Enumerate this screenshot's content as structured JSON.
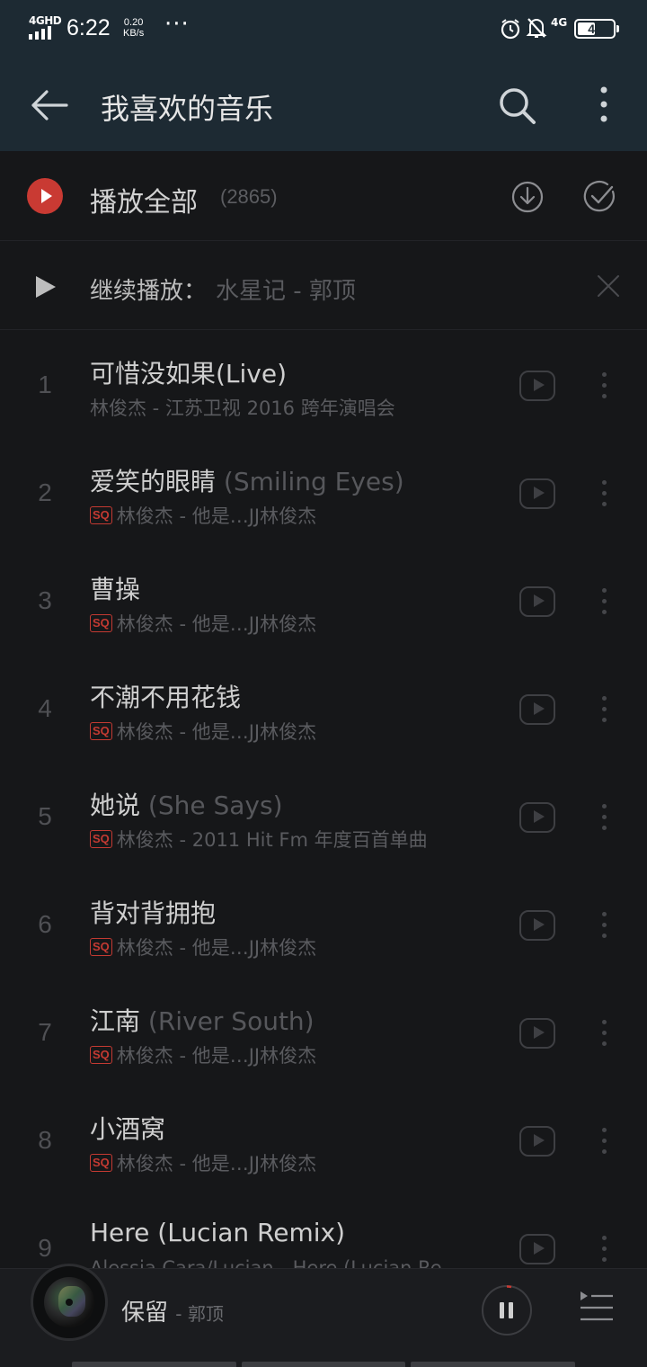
{
  "status_bar": {
    "network_label": "4GHD",
    "time": "6:22",
    "speed_value": "0.20",
    "speed_unit": "KB/s",
    "more": "···",
    "network_type": "4G",
    "battery_level": "49",
    "battery_fraction": 0.49
  },
  "header": {
    "title": "我喜欢的音乐",
    "back_icon": "back-arrow-icon",
    "search_icon": "search-icon",
    "more_icon": "more-vertical-icon"
  },
  "play_all": {
    "label": "播放全部",
    "count": "(2865)",
    "accent_color": "#c93a33"
  },
  "continue": {
    "label": "继续播放：",
    "song": "水星记 - 郭顶"
  },
  "tracks": [
    {
      "num": "1",
      "title": "可惜没如果(Live)",
      "alias": "",
      "sq": false,
      "sub": "林俊杰 - 江苏卫视 2016 跨年演唱会"
    },
    {
      "num": "2",
      "title": "爱笑的眼睛",
      "alias": "(Smiling Eyes)",
      "sq": true,
      "sub": "林俊杰 - 他是…JJ林俊杰"
    },
    {
      "num": "3",
      "title": "曹操",
      "alias": "",
      "sq": true,
      "sub": "林俊杰 - 他是…JJ林俊杰"
    },
    {
      "num": "4",
      "title": "不潮不用花钱",
      "alias": "",
      "sq": true,
      "sub": "林俊杰 - 他是…JJ林俊杰"
    },
    {
      "num": "5",
      "title": "她说",
      "alias": "(She Says)",
      "sq": true,
      "sub": "林俊杰 - 2011 Hit Fm 年度百首单曲"
    },
    {
      "num": "6",
      "title": "背对背拥抱",
      "alias": "",
      "sq": true,
      "sub": "林俊杰 - 他是…JJ林俊杰"
    },
    {
      "num": "7",
      "title": "江南",
      "alias": "(River South)",
      "sq": true,
      "sub": "林俊杰 - 他是…JJ林俊杰"
    },
    {
      "num": "8",
      "title": "小酒窝",
      "alias": "",
      "sq": true,
      "sub": "林俊杰 - 他是…JJ林俊杰"
    },
    {
      "num": "9",
      "title": "Here (Lucian Remix)",
      "alias": "",
      "sq": false,
      "sub": "Alessia Cara/Lucian - Here (Lucian Re"
    }
  ],
  "sq_badge": "SQ",
  "player": {
    "song": "保留",
    "artist": "- 郭顶",
    "progress": 0.03
  }
}
